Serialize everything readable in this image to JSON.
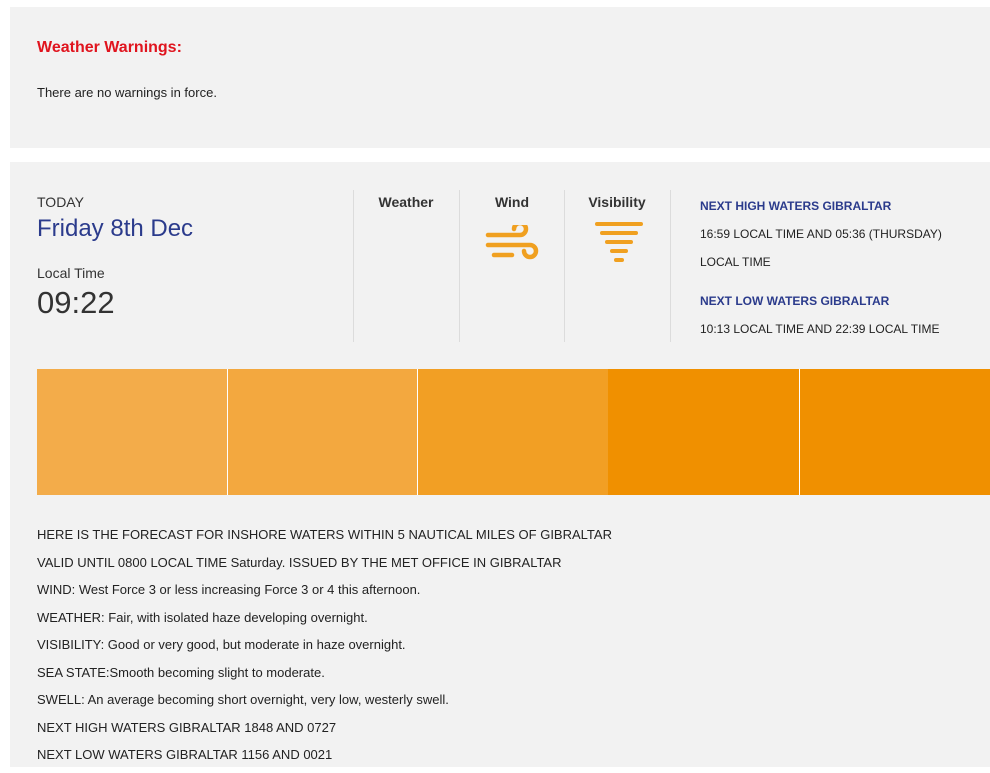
{
  "warnings": {
    "title": "Weather Warnings:",
    "text": "There are no warnings in force."
  },
  "today": {
    "label": "TODAY",
    "date": "Friday 8th Dec",
    "local_time_label": "Local Time",
    "local_time": "09:22"
  },
  "columns": {
    "weather": "Weather",
    "wind": "Wind",
    "visibility": "Visibility"
  },
  "icons": {
    "wind": "wind-icon",
    "visibility": "fog-icon"
  },
  "colors": {
    "warning_red": "#e0141e",
    "navy": "#2b3b8c",
    "icon_orange": "#f0a020",
    "strip": [
      "#f3ac4a",
      "#f3a83f",
      "#f29f24",
      "#f09000",
      "#f09000"
    ]
  },
  "tides": {
    "high_heading": "NEXT HIGH WATERS GIBRALTAR",
    "high_line1": "16:59 LOCAL TIME AND 05:36 (THURSDAY)",
    "high_line2": "LOCAL TIME",
    "low_heading": "NEXT LOW WATERS GIBRALTAR",
    "low_line1": "10:13 LOCAL TIME AND 22:39 LOCAL TIME"
  },
  "forecast_lines": [
    "HERE IS THE FORECAST FOR INSHORE WATERS WITHIN 5 NAUTICAL MILES OF GIBRALTAR",
    "VALID UNTIL 0800 LOCAL TIME Saturday. ISSUED BY THE MET OFFICE IN GIBRALTAR",
    "WIND: West Force 3 or less increasing Force 3 or 4 this afternoon.",
    "WEATHER: Fair, with isolated haze developing overnight.",
    "VISIBILITY: Good or very good, but moderate in haze overnight.",
    "SEA STATE:Smooth becoming slight to moderate.",
    "SWELL: An average becoming short overnight, very low, westerly swell.",
    "NEXT HIGH WATERS GIBRALTAR 1848 AND 0727",
    "NEXT LOW WATERS GIBRALTAR 1156 AND 0021"
  ]
}
